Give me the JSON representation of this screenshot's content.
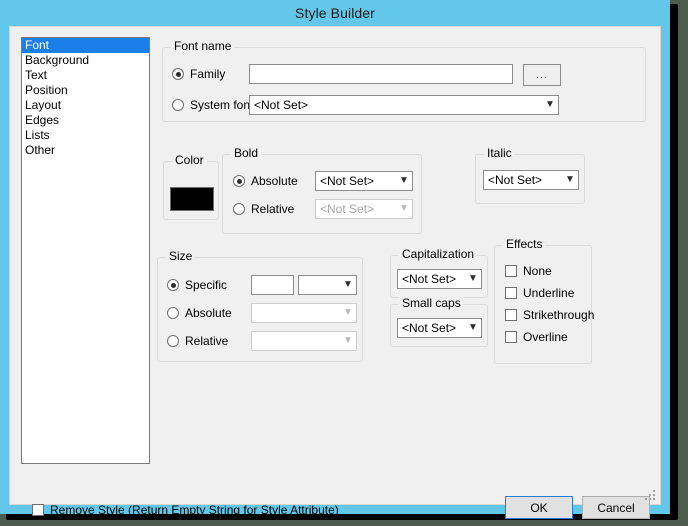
{
  "window": {
    "title": "Style Builder",
    "accent_color": "#62c7e8",
    "client_bg": "#f0f0f0",
    "desktop_bg": "#4c5b4c"
  },
  "categories": {
    "name": "Style category list",
    "selected": "Font",
    "items": [
      {
        "label": "Font",
        "selected": true
      },
      {
        "label": "Background",
        "selected": false
      },
      {
        "label": "Text",
        "selected": false
      },
      {
        "label": "Position",
        "selected": false
      },
      {
        "label": "Layout",
        "selected": false
      },
      {
        "label": "Edges",
        "selected": false
      },
      {
        "label": "Lists",
        "selected": false
      },
      {
        "label": "Other",
        "selected": false
      }
    ]
  },
  "font_name": {
    "title": "Font name",
    "family_label": "Family",
    "family_value": "",
    "family_placeholder": "",
    "browse_label": "...",
    "system_font_label": "System font:",
    "system_font_value": "<Not Set>"
  },
  "color": {
    "title": "Color",
    "value": "#000000"
  },
  "bold": {
    "title": "Bold",
    "absolute_label": "Absolute",
    "absolute_value": "<Not Set>",
    "relative_label": "Relative",
    "relative_value": "<Not Set>"
  },
  "italic": {
    "title": "Italic",
    "value": "<Not Set>"
  },
  "size": {
    "title": "Size",
    "specific_label": "Specific",
    "specific_value": "",
    "specific_unit": "",
    "absolute_label": "Absolute",
    "absolute_value": "",
    "relative_label": "Relative",
    "relative_value": ""
  },
  "capitalization": {
    "title": "Capitalization",
    "value": "<Not Set>"
  },
  "small_caps": {
    "title": "Small caps",
    "value": "<Not Set>"
  },
  "effects": {
    "title": "Effects",
    "items": [
      {
        "label": "None",
        "checked": false
      },
      {
        "label": "Underline",
        "checked": false
      },
      {
        "label": "Strikethrough",
        "checked": false
      },
      {
        "label": "Overline",
        "checked": false
      }
    ]
  },
  "footer": {
    "remove_style_label": "Remove Style (Return Empty String for Style Attribute)",
    "remove_style_checked": false,
    "ok_label": "OK",
    "cancel_label": "Cancel"
  }
}
